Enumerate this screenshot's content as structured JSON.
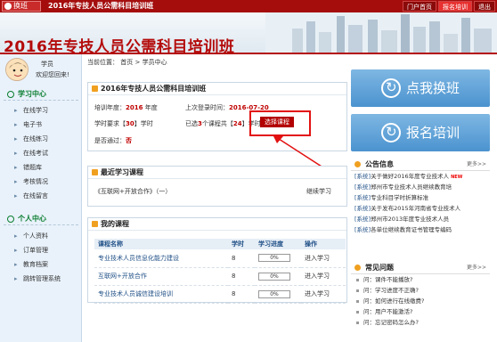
{
  "topbar": {
    "switch_label": "换班",
    "title": "2016年专技人员公需科目培训班",
    "links": [
      {
        "label": "门户首页",
        "active": false
      },
      {
        "label": "报名培训",
        "active": true
      },
      {
        "label": "退出",
        "active": false
      }
    ]
  },
  "banner": {
    "title": "2016年专技人员公需科目培训班"
  },
  "user": {
    "name": "学员",
    "welcome": "欢迎您回来!"
  },
  "sidebar": {
    "study_center": {
      "title": "学习中心",
      "items": [
        "在线学习",
        "电子书",
        "在线练习",
        "在线考试",
        "错题库",
        "考核情况",
        "在线留言"
      ]
    },
    "personal_center": {
      "title": "个人中心",
      "items": [
        "个人资料",
        "订单管理",
        "教育档案",
        "跳转管理系统"
      ]
    }
  },
  "breadcrumb": {
    "prefix": "当前位置：",
    "home": "首页",
    "sep": ">",
    "current": "学员中心"
  },
  "class_info": {
    "title": "2016年专技人员公需科目培训班",
    "year_label": "培训年度：",
    "year_value": "2016",
    "year_unit": "年度",
    "last_login_label": "上次登录时间：",
    "last_login_value": "2016-07-20",
    "req_label": "学时要求【",
    "req_value": "30",
    "req_suffix": "】学时",
    "selected_prefix": "已选",
    "selected_count": "3",
    "selected_mid": "个课程共【",
    "selected_hours": "24",
    "selected_suffix": "】学时",
    "pass_label": "是否通过：",
    "pass_value": "否",
    "select_button": "选择课程"
  },
  "recent": {
    "title": "最近学习课程",
    "course": "《互联网+开放合作》（一）",
    "action": "继续学习"
  },
  "my_courses": {
    "title": "我的课程",
    "headers": [
      "课程名称",
      "学时",
      "学习进度",
      "操作"
    ],
    "rows": [
      {
        "name": "专业技术人员信息化能力建设",
        "hours": "8",
        "progress": "0%",
        "action": "进入学习"
      },
      {
        "name": "互联网+开放合作",
        "hours": "8",
        "progress": "0%",
        "action": "进入学习"
      },
      {
        "name": "专业技术人员诚信建设培训",
        "hours": "8",
        "progress": "0%",
        "action": "进入学习"
      }
    ]
  },
  "actions": {
    "switch_class": "点我换班",
    "enroll": "报名培训"
  },
  "announcements": {
    "title": "公告信息",
    "more": "更多>>",
    "items": [
      {
        "tag": "[系统]",
        "text": "关于做好2016年度专业技术人",
        "new": "NEW"
      },
      {
        "tag": "[系统]",
        "text": "郑州市专业技术人员继续教育培",
        "new": ""
      },
      {
        "tag": "[系统]",
        "text": "专业科目学时折算标准",
        "new": ""
      },
      {
        "tag": "[系统]",
        "text": "关于发布2015年河南省专业技术人",
        "new": ""
      },
      {
        "tag": "[系统]",
        "text": "郑州市2013年度专业技术人员",
        "new": ""
      },
      {
        "tag": "[系统]",
        "text": "各单位继续教育证书管理专编码",
        "new": ""
      }
    ]
  },
  "faq": {
    "title": "常见问题",
    "more": "更多>>",
    "items": [
      "问：课件不能播放?",
      "问：学习进度不正确?",
      "问：如何进行在线缴费?",
      "问：用户不能激活?",
      "问：忘记密码怎么办?"
    ]
  }
}
